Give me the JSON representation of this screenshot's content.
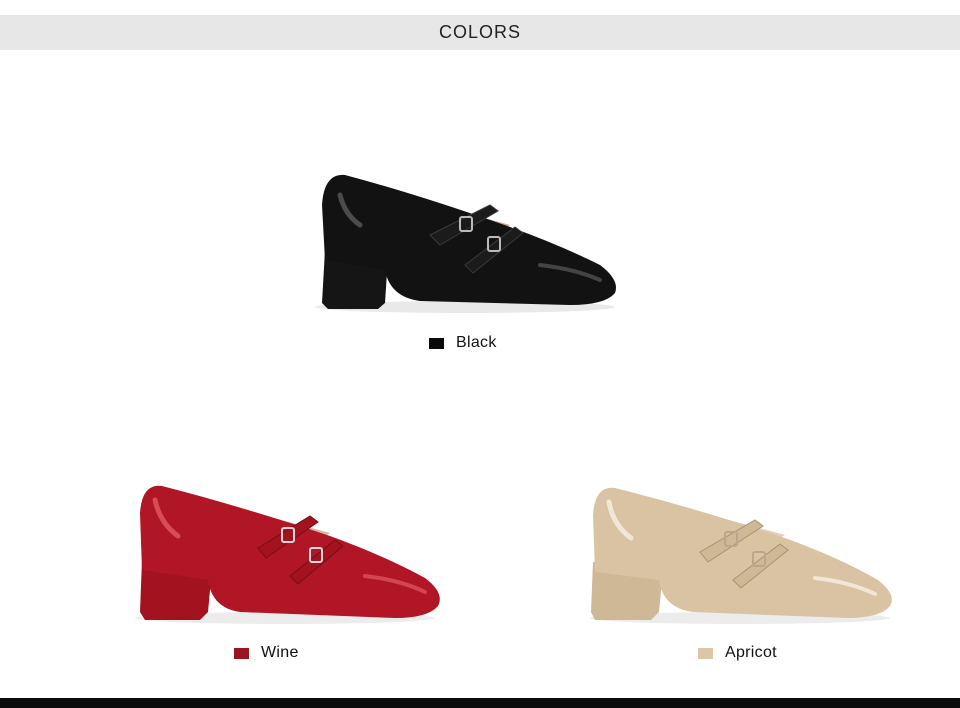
{
  "header": {
    "title": "COLORS"
  },
  "colors": [
    {
      "label": "Black",
      "swatch": "#0a0a0a",
      "body": "#121212",
      "shine": "#5a5a5a",
      "lining": "#c8a08a",
      "heel": "#151515"
    },
    {
      "label": "Wine",
      "swatch": "#9c1322",
      "body": "#b01626",
      "shine": "#e25a66",
      "lining": "#d8b7a2",
      "heel": "#a3121f"
    },
    {
      "label": "Apricot",
      "swatch": "#dcc6a4",
      "body": "#d9c3a3",
      "shine": "#f4eadb",
      "lining": "#e8cdb9",
      "heel": "#cfb896"
    }
  ],
  "footer": {
    "bar_color": "#0b0b0b"
  }
}
